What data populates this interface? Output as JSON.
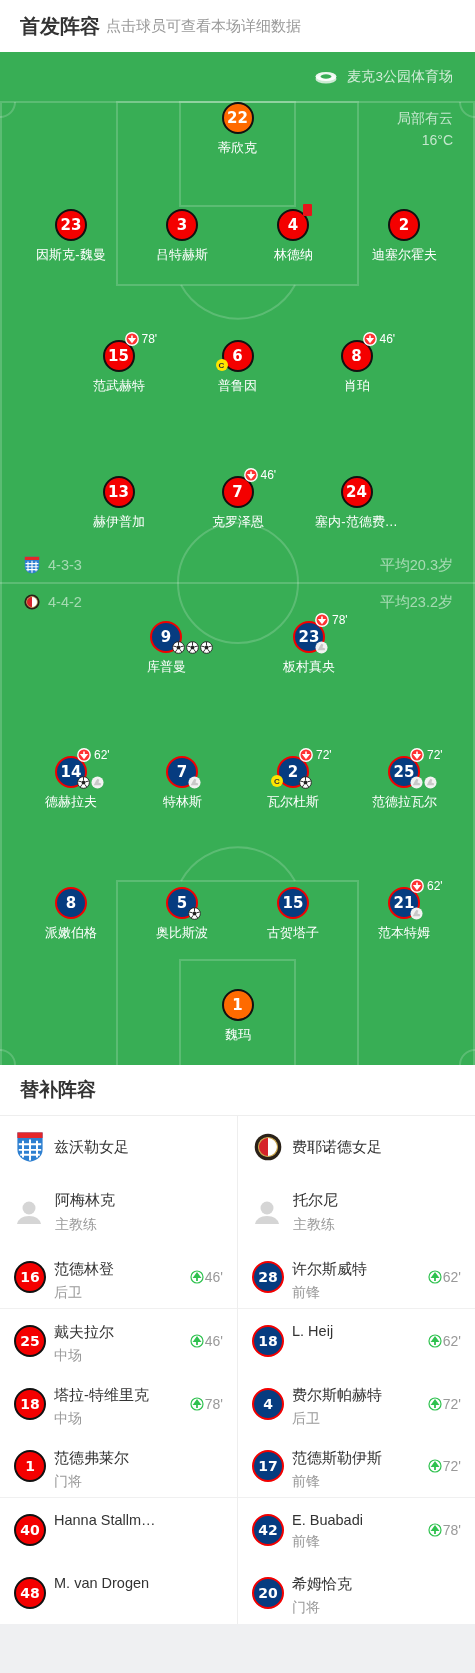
{
  "header": {
    "title": "首发阵容",
    "subtitle": "点击球员可查看本场详细数据"
  },
  "pitch": {
    "stadium": "麦克3公园体育场",
    "weather": "局部有云",
    "temperature": "16°C",
    "home": {
      "kind": "home",
      "formation": "4-3-3",
      "average_age": "平均20.3岁",
      "lines": [
        [
          {
            "number": "22",
            "name": "蒂欣克",
            "kind": "keeper"
          }
        ],
        [
          {
            "number": "23",
            "name": "因斯克-魏曼",
            "kind": "outfield"
          },
          {
            "number": "3",
            "name": "吕特赫斯",
            "kind": "outfield"
          },
          {
            "number": "4",
            "name": "林德纳",
            "kind": "outfield",
            "sent_off": true
          },
          {
            "number": "2",
            "name": "迪塞尔霍夫",
            "kind": "outfield"
          }
        ],
        [
          {
            "number": "15",
            "name": "范武赫特",
            "kind": "outfield",
            "subbed_off": "78'"
          },
          {
            "number": "6",
            "name": "普鲁因",
            "kind": "outfield",
            "captain": "C"
          },
          {
            "number": "8",
            "name": "肖珀",
            "kind": "outfield",
            "subbed_off": "46'"
          }
        ],
        [
          {
            "number": "13",
            "name": "赫伊普加",
            "kind": "outfield"
          },
          {
            "number": "7",
            "name": "克罗泽恩",
            "kind": "outfield",
            "subbed_off": "46'"
          },
          {
            "number": "24",
            "name": "塞内-范德费…",
            "kind": "outfield"
          }
        ]
      ]
    },
    "away": {
      "kind": "away",
      "formation": "4-4-2",
      "average_age": "平均23.2岁",
      "lines": [
        [
          {
            "number": "9",
            "name": "库普曼",
            "kind": "outfield",
            "events": [
              {
                "kind": "goal"
              },
              {
                "kind": "goal"
              },
              {
                "kind": "goal"
              }
            ]
          },
          {
            "number": "23",
            "name": "板村真央",
            "kind": "outfield",
            "subbed_off": "78'",
            "events": [
              {
                "kind": "assist"
              }
            ]
          }
        ],
        [
          {
            "number": "14",
            "name": "德赫拉夫",
            "kind": "outfield",
            "subbed_off": "62'",
            "events": [
              {
                "kind": "goal"
              },
              {
                "kind": "assist"
              }
            ]
          },
          {
            "number": "7",
            "name": "特林斯",
            "kind": "outfield",
            "events": [
              {
                "kind": "assist"
              }
            ]
          },
          {
            "number": "2",
            "name": "瓦尔杜斯",
            "kind": "outfield",
            "subbed_off": "72'",
            "captain": "C",
            "events": [
              {
                "kind": "goal"
              }
            ]
          },
          {
            "number": "25",
            "name": "范德拉瓦尔",
            "kind": "outfield",
            "subbed_off": "72'",
            "events": [
              {
                "kind": "assist"
              },
              {
                "kind": "assist"
              }
            ]
          }
        ],
        [
          {
            "number": "8",
            "name": "派嫩伯格",
            "kind": "outfield"
          },
          {
            "number": "5",
            "name": "奥比斯波",
            "kind": "outfield",
            "events": [
              {
                "kind": "goal"
              }
            ]
          },
          {
            "number": "15",
            "name": "古贺塔子",
            "kind": "outfield"
          },
          {
            "number": "21",
            "name": "范本特姆",
            "kind": "outfield",
            "subbed_off": "62'",
            "events": [
              {
                "kind": "assist"
              }
            ]
          }
        ],
        [
          {
            "number": "1",
            "name": "魏玛",
            "kind": "keeper"
          }
        ]
      ]
    }
  },
  "substitutes": {
    "title": "替补阵容",
    "teams": [
      {
        "kind": "home",
        "name": "兹沃勒女足",
        "coach": {
          "name": "阿梅林克",
          "role": "主教练"
        },
        "players": [
          {
            "number": "16",
            "name": "范德林登",
            "position": "后卫",
            "subbed_on": "46'"
          },
          {
            "number": "25",
            "name": "戴夫拉尔",
            "position": "中场",
            "subbed_on": "46'"
          },
          {
            "number": "18",
            "name": "塔拉-特维里克",
            "position": "中场",
            "subbed_on": "78'"
          },
          {
            "number": "1",
            "name": "范德弗莱尔",
            "position": "门将"
          },
          {
            "number": "40",
            "name": "Hanna Stallm…"
          },
          {
            "number": "48",
            "name": "M. van Drogen"
          }
        ]
      },
      {
        "kind": "away",
        "name": "费耶诺德女足",
        "coach": {
          "name": "托尔尼",
          "role": "主教练"
        },
        "players": [
          {
            "number": "28",
            "name": "许尔斯威特",
            "position": "前锋",
            "subbed_on": "62'"
          },
          {
            "number": "18",
            "name": "L. Heij",
            "subbed_on": "62'"
          },
          {
            "number": "4",
            "name": "费尔斯帕赫特",
            "position": "后卫",
            "subbed_on": "72'"
          },
          {
            "number": "17",
            "name": "范德斯勒伊斯",
            "position": "前锋",
            "subbed_on": "72'"
          },
          {
            "number": "42",
            "name": "E. Buabadi",
            "position": "前锋",
            "subbed_on": "78'"
          },
          {
            "number": "20",
            "name": "希姆恰克",
            "position": "门将"
          }
        ]
      }
    ]
  }
}
